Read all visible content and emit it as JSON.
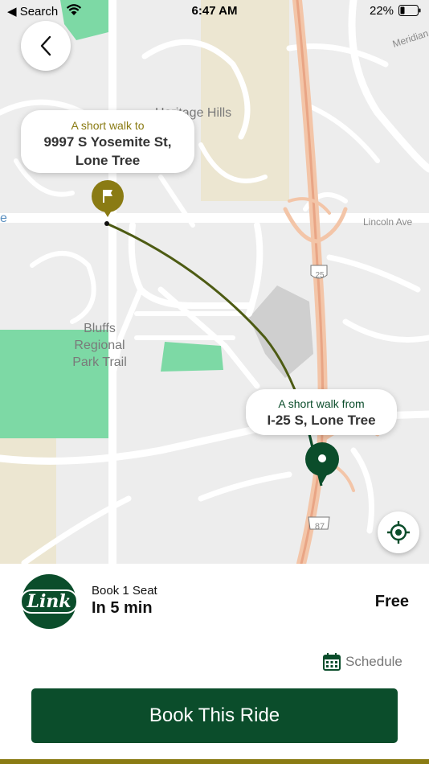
{
  "status_bar": {
    "back_app": "◀ Search",
    "time": "6:47 AM",
    "battery_pct": "22%"
  },
  "map": {
    "labels": {
      "heritage_hills": "Heritage Hills",
      "meridian": "Meridian",
      "lincoln_ave": "Lincoln Ave",
      "park_line1": "Bluffs",
      "park_line2": "Regional",
      "park_line3": "Park Trail",
      "shield_25": "25",
      "shield_87": "87",
      "edge_e": "e"
    },
    "destination": {
      "subtitle": "A short walk to",
      "line1": "9997 S Yosemite St,",
      "line2": "Lone Tree"
    },
    "origin": {
      "subtitle": "A short walk from",
      "line1": "I-25 S, Lone Tree"
    }
  },
  "ride": {
    "book_seat": "Book 1 Seat",
    "eta": "In 5 min",
    "price": "Free",
    "logo_text": "Link",
    "schedule_label": "Schedule",
    "cta_label": "Book This Ride"
  },
  "colors": {
    "brand_green": "#0b4d2b",
    "gold": "#8a7b13",
    "park_green": "#7dd9a5"
  }
}
